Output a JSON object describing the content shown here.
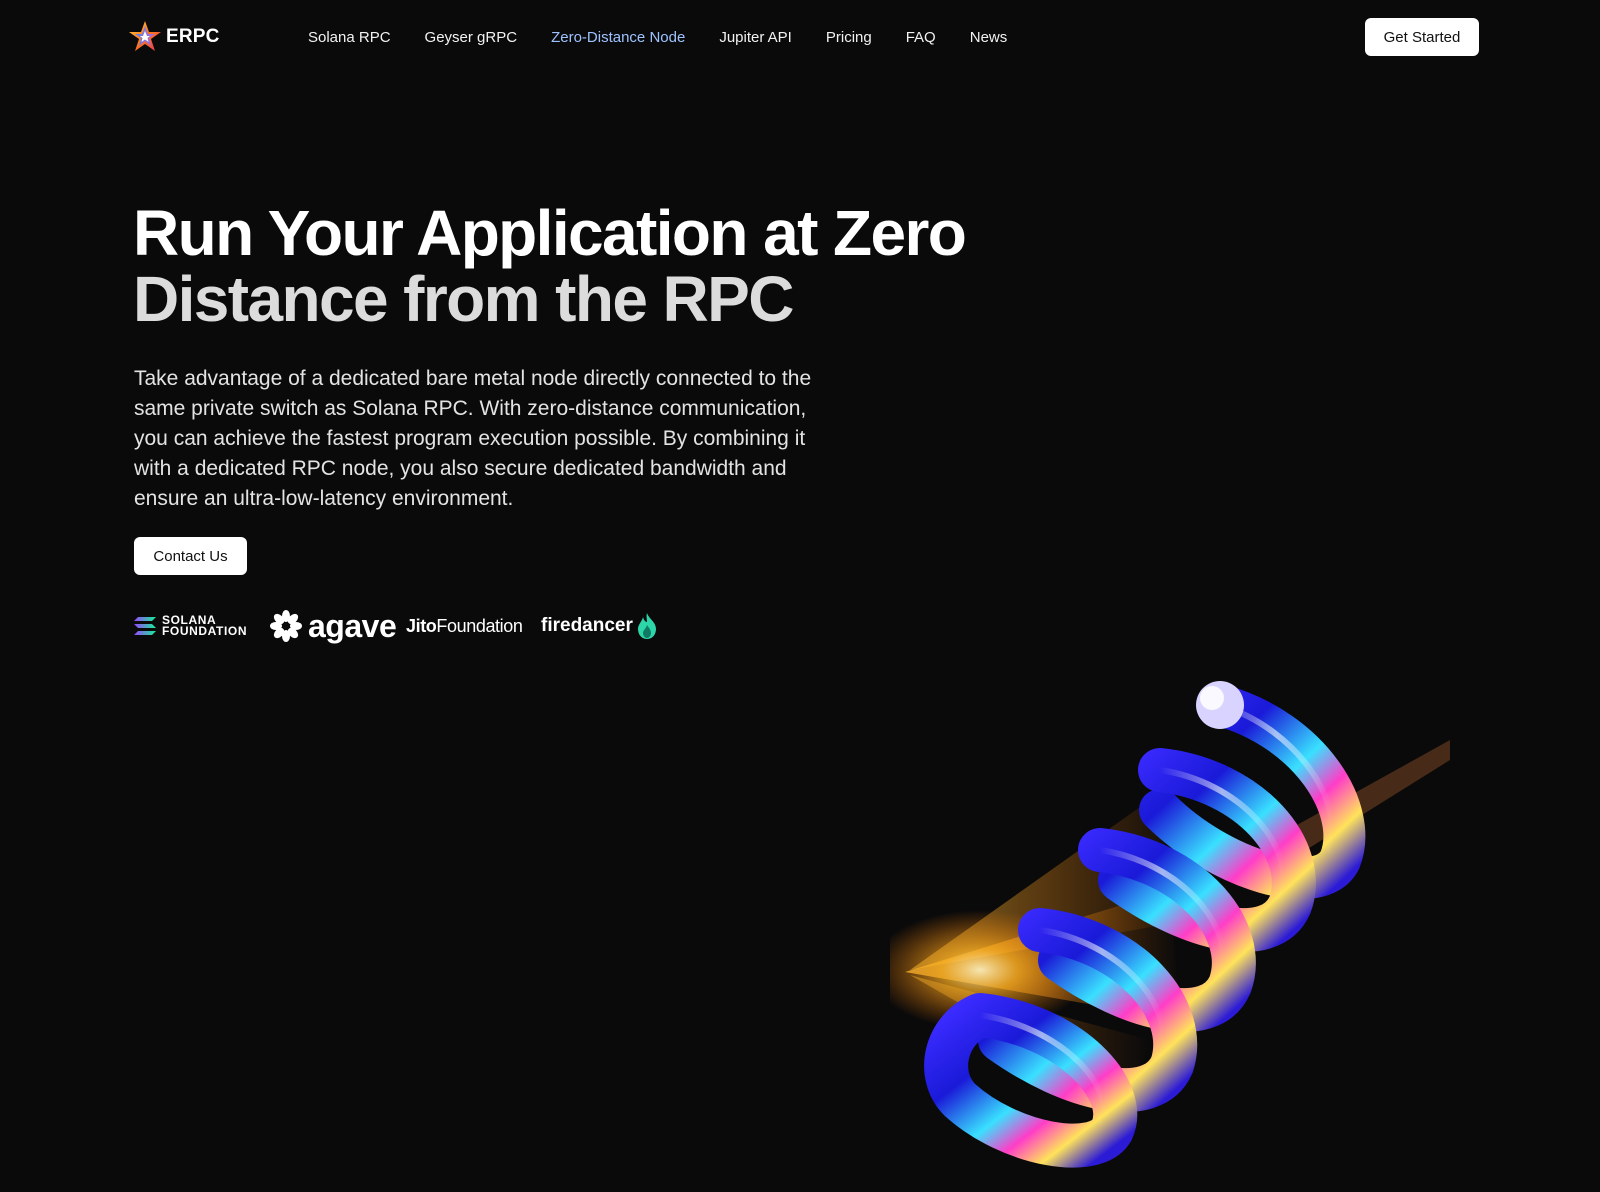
{
  "brand": {
    "name": "ERPC",
    "logo_icon": "erpc-star-logo"
  },
  "nav": {
    "items": [
      {
        "label": "Solana RPC",
        "active": false
      },
      {
        "label": "Geyser gRPC",
        "active": false
      },
      {
        "label": "Zero-Distance Node",
        "active": true
      },
      {
        "label": "Jupiter API",
        "active": false
      },
      {
        "label": "Pricing",
        "active": false
      },
      {
        "label": "FAQ",
        "active": false
      },
      {
        "label": "News",
        "active": false
      }
    ],
    "cta_label": "Get Started"
  },
  "hero": {
    "title_line1": "Run Your Application at Zero",
    "title_line2": "Distance from the RPC",
    "description": "Take advantage of a dedicated bare metal node directly connected to the same private switch as Solana RPC. With zero-distance communication, you can achieve the fastest program execution possible. By combining it with a dedicated RPC node, you also secure dedicated bandwidth and ensure an ultra-low-latency environment.",
    "cta_label": "Contact Us"
  },
  "partners": {
    "solana": {
      "line1": "SOLANA",
      "line2": "FOUNDATION",
      "icon": "solana-icon"
    },
    "agave": {
      "word": "agave",
      "icon": "agave-flower-icon"
    },
    "jito": {
      "bold": "Jito",
      "rest": "Foundation"
    },
    "firedancer": {
      "word": "firedancer",
      "icon": "flame-icon"
    }
  },
  "colors": {
    "background": "#0a0a0b",
    "active_nav": "#9dc3ff",
    "button_bg": "#ffffff",
    "button_text": "#111111"
  },
  "artwork": {
    "name": "iridescent-spiral-coil"
  }
}
